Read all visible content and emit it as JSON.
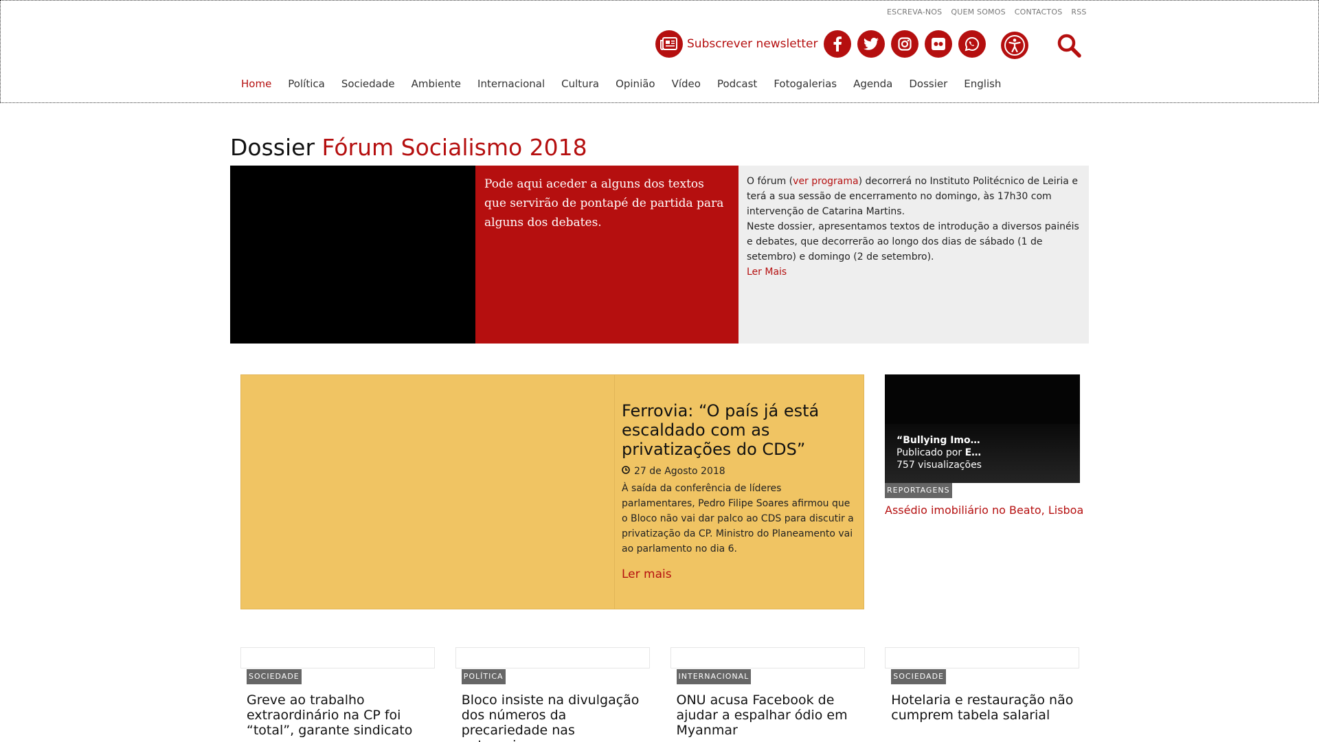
{
  "header": {
    "top_links": [
      "ESCREVA-NOS",
      "QUEM SOMOS",
      "CONTACTOS",
      "RSS"
    ],
    "newsletter_label": "Subscrever newsletter",
    "social": [
      "facebook-icon",
      "twitter-icon",
      "instagram-icon",
      "flickr-icon",
      "whatsapp-icon"
    ],
    "nav": [
      "Home",
      "Política",
      "Sociedade",
      "Ambiente",
      "Internacional",
      "Cultura",
      "Opinião",
      "Vídeo",
      "Podcast",
      "Fotogalerias",
      "Agenda",
      "Dossier",
      "English"
    ],
    "nav_active": "Home",
    "accent_color": "#b50f0f"
  },
  "dossier": {
    "prefix": "Dossier",
    "name": "Fórum Socialismo 2018",
    "intro": "Pode aqui aceder a alguns dos textos que servirão de pontapé de partida para alguns dos debates.",
    "text_1": "O fórum (",
    "text_link": "ver programa",
    "text_2": ") decorrerá no Instituto Politécnico de Leiria e terá a sua sessão de encerramento no domingo, às 17h30 com intervenção de Catarina Martins.",
    "text_3": "Neste dossier, apresentamos textos de introdução a diversos painéis e debates, que decorrerão ao longo dos dias de sábado (1 de setembro) e domingo (2 de setembro).",
    "read_more": "Ler Mais"
  },
  "feature": {
    "title": "Ferrovia: “O país já está escaldado com as privatizações do CDS”",
    "date": "27 de Agosto 2018",
    "excerpt": "À saída da conferência de líderes parlamentares, Pedro Filipe Soares  afirmou que o Bloco não vai dar palco ao CDS para discutir a privatização da CP. Ministro do Planeamento vai ao parlamento no dia 6.",
    "read_more": "Ler mais"
  },
  "video": {
    "title": "“Bullying Imo…",
    "published_prefix": "Publicado por ",
    "author": "E…",
    "views": "757 visualizações"
  },
  "side": {
    "tag": "REPORTAGENS",
    "link": "Assédio imobiliário no Beato, Lisboa"
  },
  "cards": [
    {
      "tag": "SOCIEDADE",
      "title": "Greve ao trabalho extraordinário na CP foi “total”, garante sindicato"
    },
    {
      "tag": "POLÍTICA",
      "title": "Bloco insiste na divulgação dos números da precariedade nas autarquias"
    },
    {
      "tag": "INTERNACIONAL",
      "title": "ONU acusa Facebook de ajudar a espalhar ódio em Myanmar"
    },
    {
      "tag": "SOCIEDADE",
      "title": "Hotelaria e restauração não cumprem tabela salarial"
    }
  ]
}
